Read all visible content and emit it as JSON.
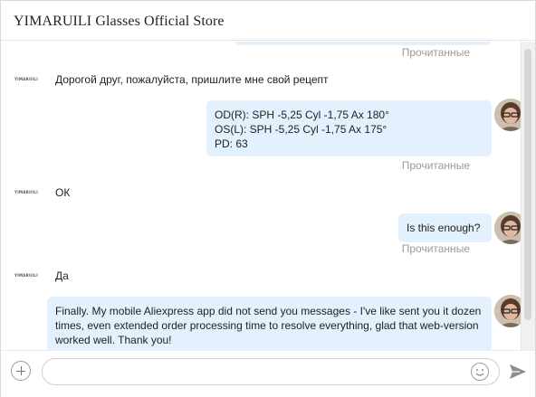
{
  "header": {
    "title": "YIMARUILI Glasses Official Store"
  },
  "store": {
    "logo_text": "YIMARUILI"
  },
  "messages": [
    {
      "read_label": "Прочитанные"
    },
    {
      "text": "Дорогой друг, пожалуйста, пришлите мне свой рецепт"
    },
    {
      "lines": [
        "OD(R): SPH -5,25 Cyl -1,75 Ax 180°",
        "OS(L): SPH -5,25 Cyl -1,75 Ax 175°",
        "PD: 63"
      ],
      "read_label": "Прочитанные"
    },
    {
      "text": "ОК"
    },
    {
      "text": "Is this enough?",
      "read_label": "Прочитанные"
    },
    {
      "text": "Да"
    },
    {
      "text": "Finally. My mobile Aliexpress app did not send you messages - I've like sent you it dozen times, even extended order processing time to resolve everything, glad that web-version worked well. Thank you!"
    }
  ],
  "composer": {
    "placeholder": "",
    "value": ""
  },
  "icons": {
    "add": "plus-circle-icon",
    "emoji": "smiley-icon",
    "send": "paper-plane-icon",
    "avatar": "user-avatar"
  },
  "colors": {
    "bubble_out": "#e3f0fd",
    "status_text": "#9a9a9a",
    "border": "#cfcfcf"
  }
}
